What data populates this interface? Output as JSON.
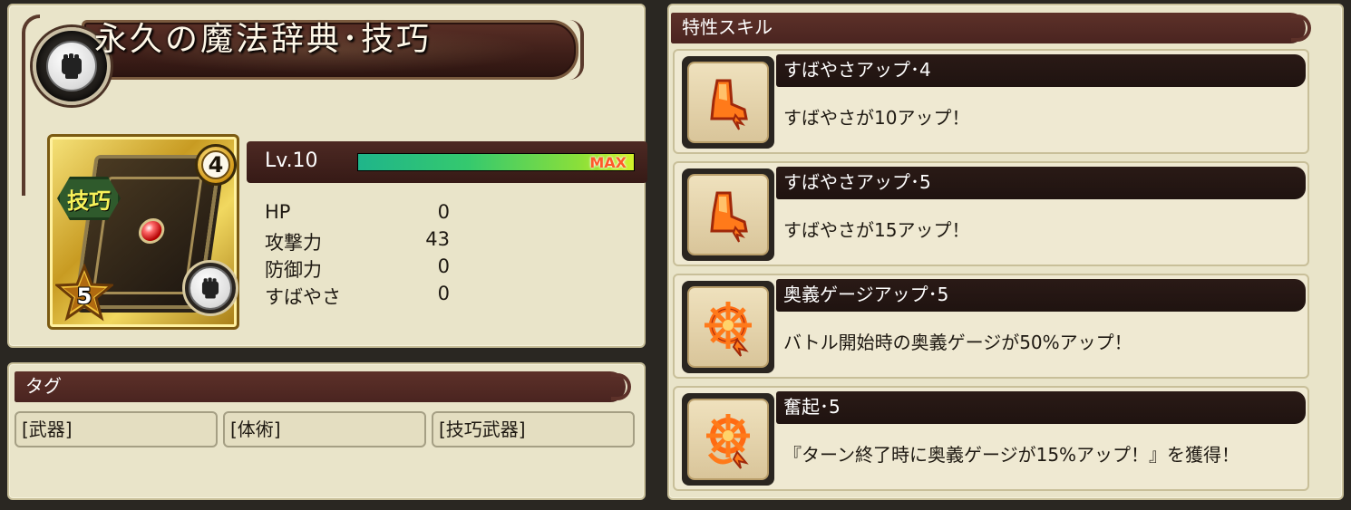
{
  "item": {
    "title": "永久の魔法辞典･技巧",
    "type_badge": "技巧",
    "limit_break": "4",
    "rarity": "5",
    "level_label": "Lv.10",
    "level_max_label": "MAX",
    "level_progress": 1.0
  },
  "stats": [
    {
      "name": "HP",
      "value": "0"
    },
    {
      "name": "攻撃力",
      "value": "43"
    },
    {
      "name": "防御力",
      "value": "0"
    },
    {
      "name": "すばやさ",
      "value": "0"
    }
  ],
  "tags": {
    "header": "タグ",
    "items": [
      "[武器]",
      "[体術]",
      "[技巧武器]"
    ]
  },
  "skills": {
    "header": "特性スキル",
    "items": [
      {
        "title": "すばやさアップ･4",
        "desc": "すばやさが10アップ！",
        "icon": "speed-boot-icon"
      },
      {
        "title": "すばやさアップ･5",
        "desc": "すばやさが15アップ！",
        "icon": "speed-boot-icon"
      },
      {
        "title": "奥義ゲージアップ･5",
        "desc": "バトル開始時の奥義ゲージが50%アップ！",
        "icon": "burst-gauge-icon"
      },
      {
        "title": "奮起･5",
        "desc": "『ターン終了時に奥義ゲージが15%アップ！』を獲得！",
        "icon": "rally-icon"
      }
    ]
  },
  "colors": {
    "panel_bg": "#e9e4c9",
    "header_bg": "#4a2420",
    "gauge_green": "#35c96e",
    "max_red": "#ff5a2a"
  }
}
